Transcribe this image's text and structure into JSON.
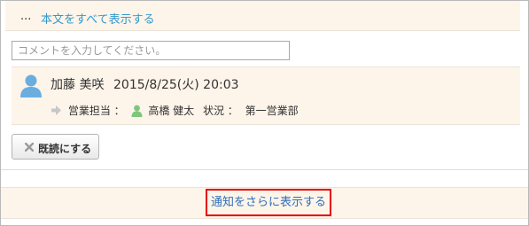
{
  "post": {
    "ellipsis": "...",
    "show_all_label": "本文をすべて表示する"
  },
  "comment": {
    "placeholder": "コメントを入力してください。"
  },
  "notification": {
    "user_name": "加藤 美咲",
    "timestamp": "2015/8/25(火) 20:03",
    "field1_label": "営業担当 ：",
    "field1_value": "高橋 健太",
    "field2_label": "状況 ：",
    "field2_value": "第一営業部"
  },
  "read_button": {
    "label": "既読にする"
  },
  "footer": {
    "more_label": "通知をさらに表示する"
  },
  "colors": {
    "band_background": "#fdf4ea",
    "link": "#3399cc",
    "highlight_border": "#e60000",
    "avatar": "#6aaee0",
    "user_icon_green": "#7cc77c"
  },
  "icons": [
    "user-avatar-icon",
    "arrow-right-icon",
    "user-icon",
    "close-x-icon"
  ]
}
